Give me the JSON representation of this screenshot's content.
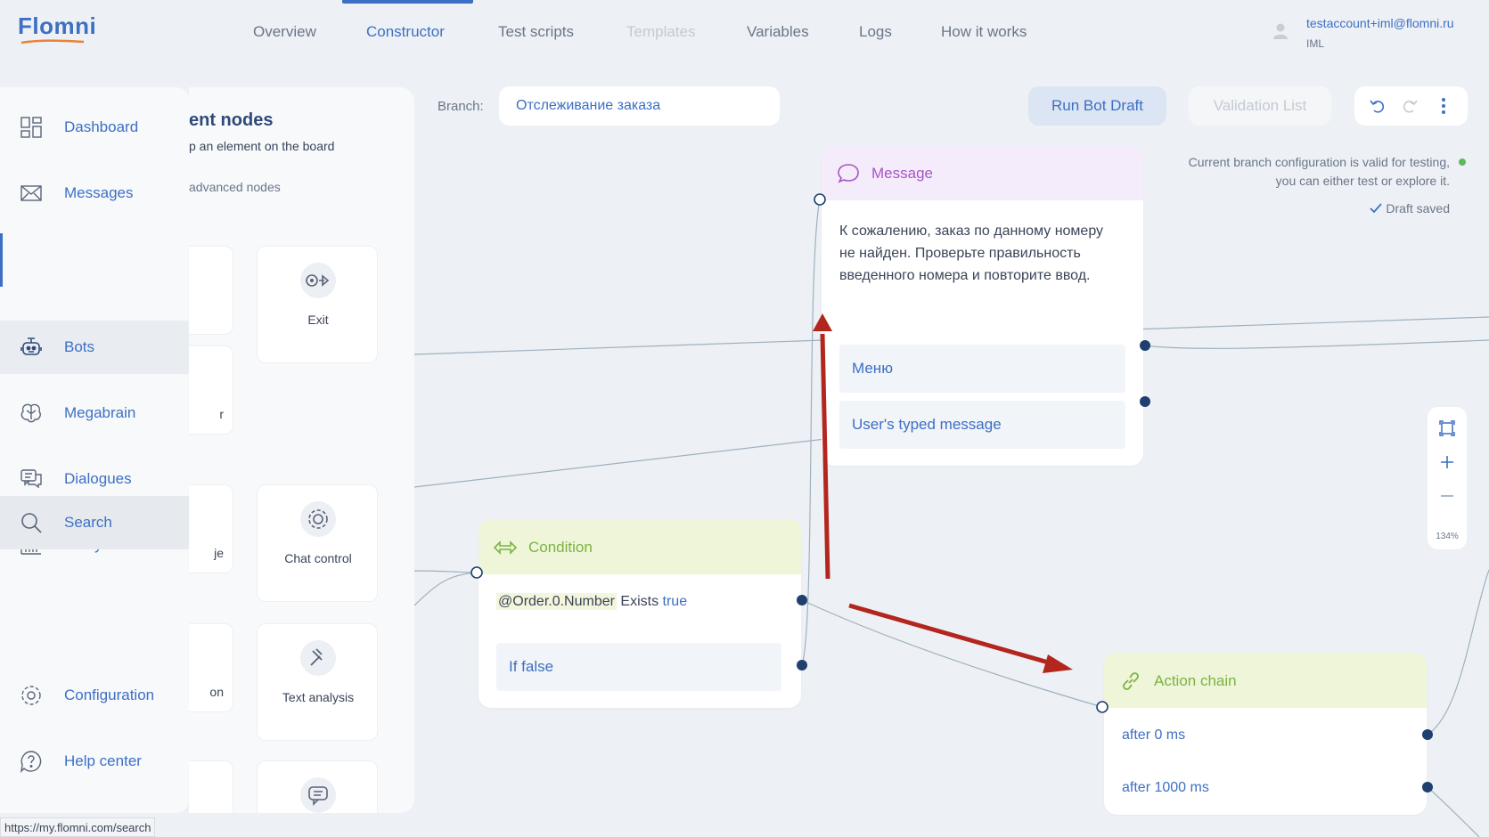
{
  "app": {
    "logo_text": "Flomni"
  },
  "nav": {
    "tabs": [
      {
        "label": "Overview",
        "state": "normal"
      },
      {
        "label": "Constructor",
        "state": "active"
      },
      {
        "label": "Test scripts",
        "state": "normal"
      },
      {
        "label": "Templates",
        "state": "disabled"
      },
      {
        "label": "Variables",
        "state": "normal"
      },
      {
        "label": "Logs",
        "state": "normal"
      },
      {
        "label": "How it works",
        "state": "normal"
      }
    ]
  },
  "user": {
    "email": "testaccount+iml@flomni.ru",
    "org": "IML",
    "icon": "user-avatar-icon"
  },
  "sidebar": {
    "items": [
      {
        "label": "Dashboard",
        "icon": "dashboard-icon"
      },
      {
        "label": "Messages",
        "icon": "envelope-icon"
      },
      {
        "label": "Bots",
        "icon": "robot-icon",
        "active": true
      },
      {
        "label": "Megabrain",
        "icon": "brain-icon"
      },
      {
        "label": "Dialogues",
        "icon": "chat-bubbles-icon"
      },
      {
        "label": "Analytics",
        "icon": "bar-chart-icon"
      },
      {
        "label": "Search",
        "icon": "search-icon",
        "hovered": true
      },
      {
        "label": "Configuration",
        "icon": "gear-icon"
      },
      {
        "label": "Help center",
        "icon": "help-icon"
      }
    ]
  },
  "palette": {
    "title": "ent nodes",
    "hint": "p an element on the board",
    "advanced": "advanced nodes",
    "cards": [
      {
        "label": "Exit",
        "icon": "exit-icon"
      },
      {
        "label": "Chat control",
        "icon": "gear-icon"
      },
      {
        "label": "Text analysis",
        "icon": "hammer-icon"
      },
      {
        "label": "",
        "icon": "message-icon"
      }
    ],
    "stub_fragments": [
      "r",
      "je",
      "on"
    ]
  },
  "toolbar": {
    "branch_label": "Branch:",
    "branch_value": "Отслеживание заказа",
    "run_label": "Run Bot Draft",
    "validation_label": "Validation List"
  },
  "status": {
    "line1": "Current branch configuration is valid for testing,",
    "line2": "you can either test or explore it.",
    "draft_saved": "Draft saved",
    "status_color": "#5cb85c"
  },
  "zoom": {
    "level": "134%"
  },
  "nodes": {
    "message": {
      "title": "Message",
      "text": "К сожалению, заказ по данному номеру не найден. Проверьте правильность введенного номера и повторите ввод.",
      "options": [
        "Меню",
        "User's typed message"
      ],
      "header_color": "#f4ecfa",
      "title_color": "#a855c7"
    },
    "condition": {
      "title": "Condition",
      "variable": "@Order.0.Number",
      "operator": "Exists",
      "value": "true",
      "else_label": "If false",
      "header_color": "#eef5d8",
      "title_color": "#7cb342"
    },
    "action_chain": {
      "title": "Action chain",
      "rows": [
        "after 0 ms",
        "after 1000 ms"
      ],
      "header_color": "#eef5d8",
      "title_color": "#7cb342"
    }
  },
  "url_tooltip": "https://my.flomni.com/search",
  "colors": {
    "accent": "#3d6fc4",
    "annotation_arrow": "#b3261e",
    "port": "#1f3f6e"
  }
}
